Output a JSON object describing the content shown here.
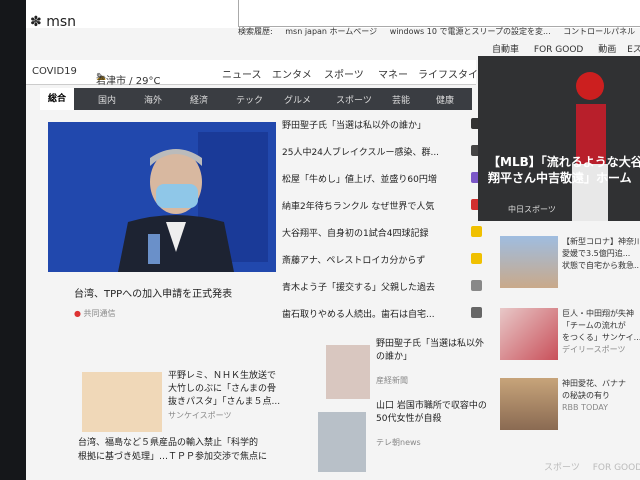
{
  "brand": "msn",
  "suggest": [
    "検索履歴:",
    "msn japan ホームページ",
    "windows 10 で電源とスリープの設定を変...",
    "コントロールパネル"
  ],
  "nav": {
    "covid": "COVID19",
    "weather": "君津市 / 29°C",
    "links": [
      "ニュース",
      "エンタメ",
      "スポーツ",
      "マネー",
      "ライフスタイル",
      "自動車",
      "FOR GOOD",
      "動画",
      "Eスポーツ"
    ]
  },
  "categories": [
    "総合",
    "国内",
    "海外",
    "経済",
    "テック",
    "グルメ",
    "スポーツ",
    "芸能",
    "健康"
  ],
  "main_story": {
    "title": "台湾、TPPへの加入申請を正式発表",
    "source": "共同通信"
  },
  "headlines": [
    {
      "text": "野田聖子氏「当選は私以外の誰か」",
      "color": "#333"
    },
    {
      "text": "25人中24人ブレイクスルー感染、群...",
      "color": "#444"
    },
    {
      "text": "松屋「牛めし」値上げ、並盛り60円増",
      "color": "#7b57c7"
    },
    {
      "text": "納車2年待ちランクル なぜ世界で人気",
      "color": "#d32f2f"
    },
    {
      "text": "大谷翔平、自身初の1試合4四球記録",
      "color": "#f0c000"
    },
    {
      "text": "斎藤アナ、ペレストロイカ分からず",
      "color": "#f0c000"
    },
    {
      "text": "青木よう子「援交する」父親した過去",
      "color": "#888"
    },
    {
      "text": "歯石取りやめる人続出。歯石は自宅...",
      "color": "#666"
    }
  ],
  "feature": {
    "line1": "【MLB】「流れるような大谷",
    "line2": "翔平さん中吉敬遠」ホーム",
    "source": "中日スポーツ"
  },
  "side_cards": [
    {
      "title": "【新型コロナ】神奈川",
      "sub": "愛媛で3.5億円追...",
      "sub2": "状態で自宅から救急..."
    },
    {
      "title": "巨人・中田翔が失神",
      "sub": "「チームの流れが",
      "sub2": "をつくる」サンケイ...",
      "source": "デイリースポーツ"
    },
    {
      "title": "神田愛花、バナナ",
      "sub": "の秘訣の有り",
      "source": "RBB TODAY"
    }
  ],
  "bottom_left": {
    "title": "平野レミ、ＮＨＫ生放送で",
    "line2": "大竹しのぶに「さんまの骨",
    "line3": "抜きパスタ」「さんま５点...",
    "source": "サンケイスポーツ"
  },
  "bottom_mid": {
    "line1": "野田聖子氏「当選は私以外",
    "line2": "の誰か」",
    "source": "産経新聞"
  },
  "bottom_mid2": {
    "line1": "山口 岩国市職所で収容中の",
    "line2": "50代女性が自殺",
    "source": "テレ朝news"
  },
  "bottom_left2": {
    "line1": "台湾、福島など５県産品の輸入禁止「科学的",
    "line2": "根拠に基づき処理」…ＴＰＰ参加交渉で焦点に"
  },
  "bottom_nav": [
    "スポーツ",
    "FOR GOOD"
  ]
}
